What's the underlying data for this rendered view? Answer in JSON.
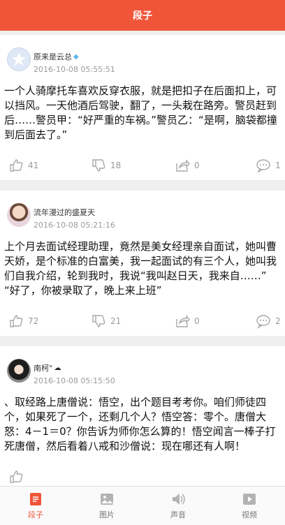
{
  "header": {
    "title": "段子"
  },
  "posts": [
    {
      "username": "原来是云总",
      "badge_icon": "diamond-icon",
      "timestamp": "2016-10-08 05:55:51",
      "text": "一个人骑摩托车喜欢反穿衣服，就是把扣子在后面扣上，可以挡风。一天他酒后驾驶，翻了，一头栽在路旁。警员赶到后……警员甲：“好严重的车祸。”警员乙：“是啊，脑袋都撞到后面去了。”",
      "likes": "41",
      "dislikes": "18",
      "shares": "0",
      "comments": "1"
    },
    {
      "username": "流年漫过的盛夏天",
      "timestamp": "2016-10-08 05:21:16",
      "text": "上个月去面试经理助理，竟然是美女经理亲自面试，她叫曹天娇，是个标准的白富美，我一起面试的有三个人，她叫我们自我介绍，轮到我时，我说“我叫赵日天，我来自……” “好了，你被录取了，晚上来上班”",
      "likes": "72",
      "dislikes": "21",
      "shares": "0",
      "comments": "2"
    },
    {
      "username": "南柯°",
      "badge_icon": "cloud-icon",
      "timestamp": "2016-10-08 05:15:50",
      "text": "、取经路上唐僧说：悟空，出个题目考考你。咱们师徒四个，如果死了一个，还剩几个人？悟空答：零个。唐僧大怒：4－1＝0？你告诉为师你怎么算的！悟空闻言一棒子打死唐僧，然后看着八戒和沙僧说：现在哪还有人啊！",
      "likes": "",
      "dislikes": "",
      "shares": "",
      "comments": ""
    }
  ],
  "tabs": [
    {
      "label": "段子",
      "icon": "document-icon",
      "active": true
    },
    {
      "label": "图片",
      "icon": "image-icon",
      "active": false
    },
    {
      "label": "声音",
      "icon": "speaker-icon",
      "active": false
    },
    {
      "label": "视频",
      "icon": "play-icon",
      "active": false
    }
  ],
  "colors": {
    "accent": "#f0553a",
    "muted": "#9a9a9a"
  }
}
